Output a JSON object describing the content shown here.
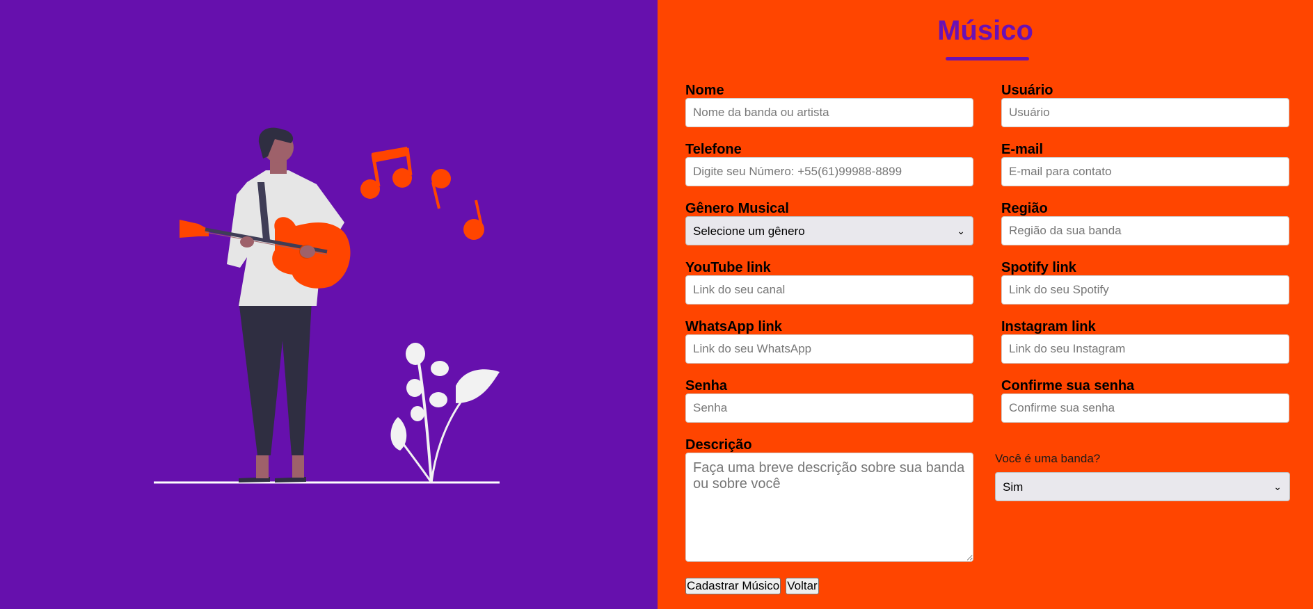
{
  "colors": {
    "left_bg": "#6610ad",
    "right_bg": "#ff4500",
    "title": "#6a11b4"
  },
  "illustration": {
    "icons": [
      "guitarist-illustration-icon",
      "music-notes-icon",
      "plant-icon"
    ]
  },
  "form": {
    "title": "Músico",
    "nome": {
      "label": "Nome",
      "placeholder": "Nome da banda ou artista"
    },
    "usuario": {
      "label": "Usuário",
      "placeholder": "Usuário"
    },
    "telefone": {
      "label": "Telefone",
      "placeholder": "Digite seu Número: +55(61)99988-8899"
    },
    "email": {
      "label": "E-mail",
      "placeholder": "E-mail para contato"
    },
    "genero": {
      "label": "Gênero Musical",
      "selected": "Selecione um gênero"
    },
    "regiao": {
      "label": "Região",
      "placeholder": "Região da sua banda"
    },
    "youtube": {
      "label": "YouTube link",
      "placeholder": "Link do seu canal"
    },
    "spotify": {
      "label": "Spotify link",
      "placeholder": "Link do seu Spotify"
    },
    "whatsapp": {
      "label": "WhatsApp link",
      "placeholder": "Link do seu WhatsApp"
    },
    "instagram": {
      "label": "Instagram link",
      "placeholder": "Link do seu Instagram"
    },
    "senha": {
      "label": "Senha",
      "placeholder": "Senha"
    },
    "confirme": {
      "label": "Confirme sua senha",
      "placeholder": "Confirme sua senha"
    },
    "descricao": {
      "label": "Descrição",
      "placeholder": "Faça uma breve descrição sobre sua banda ou sobre você"
    },
    "banda": {
      "question": "Você é uma banda?",
      "selected": "Sim"
    },
    "buttons": {
      "submit": "Cadastrar Músico",
      "back": "Voltar"
    }
  }
}
